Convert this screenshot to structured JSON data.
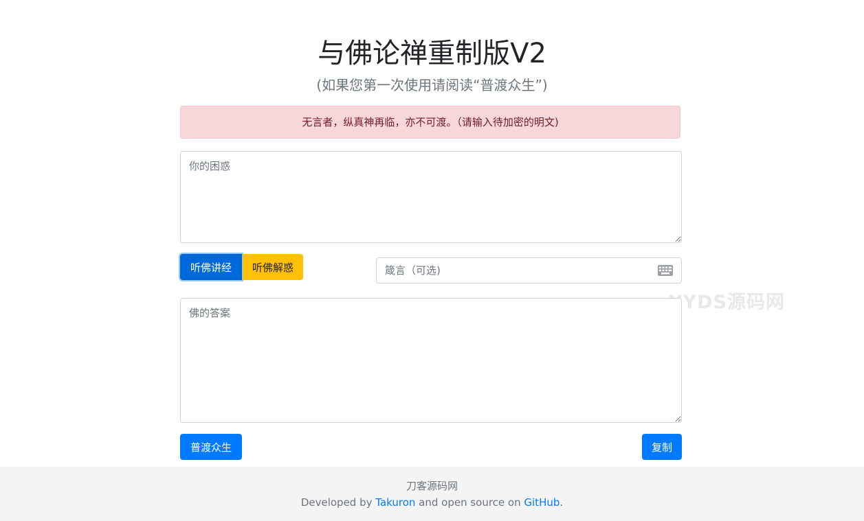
{
  "header": {
    "title": "与佛论禅重制版V2",
    "subtitle": "(如果您第一次使用请阅读“普渡众生”)"
  },
  "alert": {
    "text": "无言者，纵真神再临，亦不可渡。（请输入待加密的明文)"
  },
  "plaintext": {
    "placeholder": "你的困惑",
    "value": ""
  },
  "actions": {
    "encode_label": "听佛讲经",
    "decode_label": "听佛解惑"
  },
  "key": {
    "placeholder": "箴言（可选)",
    "value": "",
    "icon": "keyboard-icon"
  },
  "ciphertext": {
    "placeholder": "佛的答案",
    "value": ""
  },
  "bottom": {
    "help_label": "普渡众生",
    "copy_label": "复制"
  },
  "watermark": {
    "text": "YYDS源码网"
  },
  "footer": {
    "site_name": "刀客源码网",
    "developed_by": "Developed by ",
    "author": "Takuron",
    "and_open_source": " and open source on ",
    "github": "GitHub",
    "period": "."
  },
  "colors": {
    "primary": "#007bff",
    "primary_active": "#0069d9",
    "warning": "#ffc107",
    "alert_bg": "#f8d7da",
    "alert_text": "#721c24",
    "footer_bg": "#f4f4f4"
  }
}
